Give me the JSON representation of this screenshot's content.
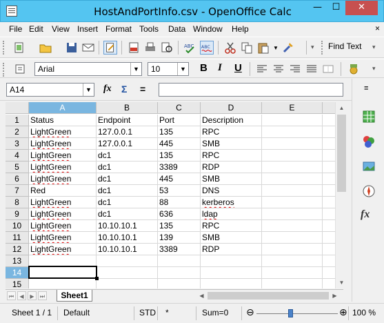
{
  "window": {
    "title": "HostAndPortInfo.csv - OpenOffice Calc",
    "minimize": "—",
    "maximize": "☐",
    "close": "✕"
  },
  "menu": {
    "items": [
      "File",
      "Edit",
      "View",
      "Insert",
      "Format",
      "Tools",
      "Data",
      "Window",
      "Help"
    ],
    "close_doc": "×"
  },
  "toolbar": {
    "find_text_label": "Find Text",
    "font_name": "Arial",
    "font_size": "10",
    "bold": "B",
    "italic": "I",
    "underline": "U"
  },
  "formula_bar": {
    "name_box": "A14",
    "fx": "fx",
    "sum": "Σ",
    "equals": "=",
    "content": ""
  },
  "grid": {
    "columns": [
      "A",
      "B",
      "C",
      "D",
      "E"
    ],
    "rows": [
      "1",
      "2",
      "3",
      "4",
      "5",
      "6",
      "7",
      "8",
      "9",
      "10",
      "11",
      "12",
      "13",
      "14",
      "15"
    ],
    "selected_cell": "A14",
    "cells": [
      [
        "Status",
        "Endpoint",
        "Port",
        "Description",
        ""
      ],
      [
        "LightGreen",
        "127.0.0.1",
        "135",
        "RPC",
        ""
      ],
      [
        "LightGreen",
        "127.0.0.1",
        "445",
        "SMB",
        ""
      ],
      [
        "LightGreen",
        "dc1",
        "135",
        "RPC",
        ""
      ],
      [
        "LightGreen",
        "dc1",
        "3389",
        "RDP",
        ""
      ],
      [
        "LightGreen",
        "dc1",
        "445",
        "SMB",
        ""
      ],
      [
        "Red",
        "dc1",
        "53",
        "DNS",
        ""
      ],
      [
        "LightGreen",
        "dc1",
        "88",
        "kerberos",
        ""
      ],
      [
        "LightGreen",
        "dc1",
        "636",
        "ldap",
        ""
      ],
      [
        "LightGreen",
        "10.10.10.1",
        "135",
        "RPC",
        ""
      ],
      [
        "LightGreen",
        "10.10.10.1",
        "139",
        "SMB",
        ""
      ],
      [
        "LightGreen",
        "10.10.10.1",
        "3389",
        "RDP",
        ""
      ],
      [
        "",
        "",
        "",
        "",
        ""
      ],
      [
        "",
        "",
        "",
        "",
        ""
      ],
      [
        "",
        "",
        "",
        "",
        ""
      ]
    ]
  },
  "sheet_tabs": {
    "active": "Sheet1"
  },
  "status_bar": {
    "sheet": "Sheet 1 / 1",
    "page_style": "Default",
    "mode": "STD",
    "star": "*",
    "sum": "Sum=0",
    "zoom_minus": "⊖",
    "zoom_plus": "⊕",
    "zoom": "100 %"
  },
  "colors": {
    "title_bar": "#54c5f1",
    "header_selected": "#7ab6e0",
    "close_button": "#c75050"
  }
}
